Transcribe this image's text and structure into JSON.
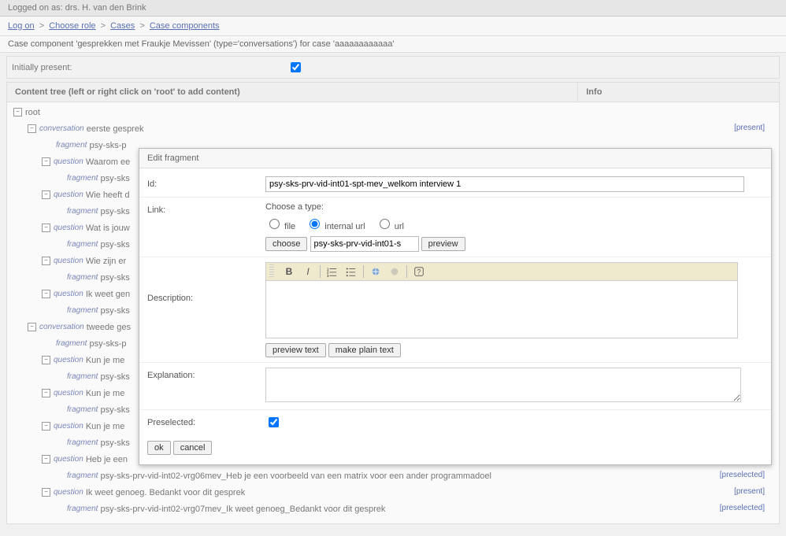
{
  "login_text": "Logged on as: drs. H. van den Brink",
  "breadcrumb": {
    "logon": "Log on",
    "choose_role": "Choose role",
    "cases": "Cases",
    "case_components": "Case components",
    "sep": ">"
  },
  "subheader": "Case component 'gesprekken met Fraukje Mevissen' (type='conversations') for case 'aaaaaaaaaaaa'",
  "initially_present_label": "Initially present:",
  "content_tree_header": "Content tree (left or right click on 'root' to add content)",
  "info_header": "Info",
  "tree": {
    "root": "root",
    "conv1": "eerste gesprek",
    "frag_prefix": "psy-sks-p",
    "q_waarom": "Waarom ee",
    "q_wie": "Wie heeft d",
    "q_wat": "Wat is jouw",
    "q_zijn": "Wie zijn er",
    "q_ikweet": "Ik weet gen",
    "conv2": "tweede ges",
    "q_kun1": "Kun je me",
    "q_kun2": "Kun je me",
    "q_kun3": "Kun je me",
    "q_heb": "Heb je een",
    "frag_long": "psy-sks-prv-vid-int02-vrg06mev_Heb je een voorbeeld van een matrix voor een ander programmadoel",
    "q_ikweet2": "Ik weet genoeg. Bedankt voor dit gesprek",
    "frag_long2": "psy-sks-prv-vid-int02-vrg07mev_Ik weet genoeg_Bedankt voor dit gesprek",
    "frag_generic": "psy-sks",
    "type_conversation": "conversation",
    "type_question": "question",
    "type_fragment": "fragment",
    "status_present": "[present]",
    "status_preselected": "[preselected]"
  },
  "modal": {
    "title": "Edit fragment",
    "id_label": "Id:",
    "id_value": "psy-sks-prv-vid-int01-spt-mev_welkom interview 1",
    "link_label": "Link:",
    "choose_type": "Choose a type:",
    "radio_file": "file",
    "radio_internal": "internal url",
    "radio_url": "url",
    "choose_btn": "choose",
    "link_value": "psy-sks-prv-vid-int01-s",
    "preview_btn": "preview",
    "description_label": "Description:",
    "preview_text_btn": "preview text",
    "make_plain_btn": "make plain text",
    "explanation_label": "Explanation:",
    "preselected_label": "Preselected:",
    "ok": "ok",
    "cancel": "cancel"
  }
}
